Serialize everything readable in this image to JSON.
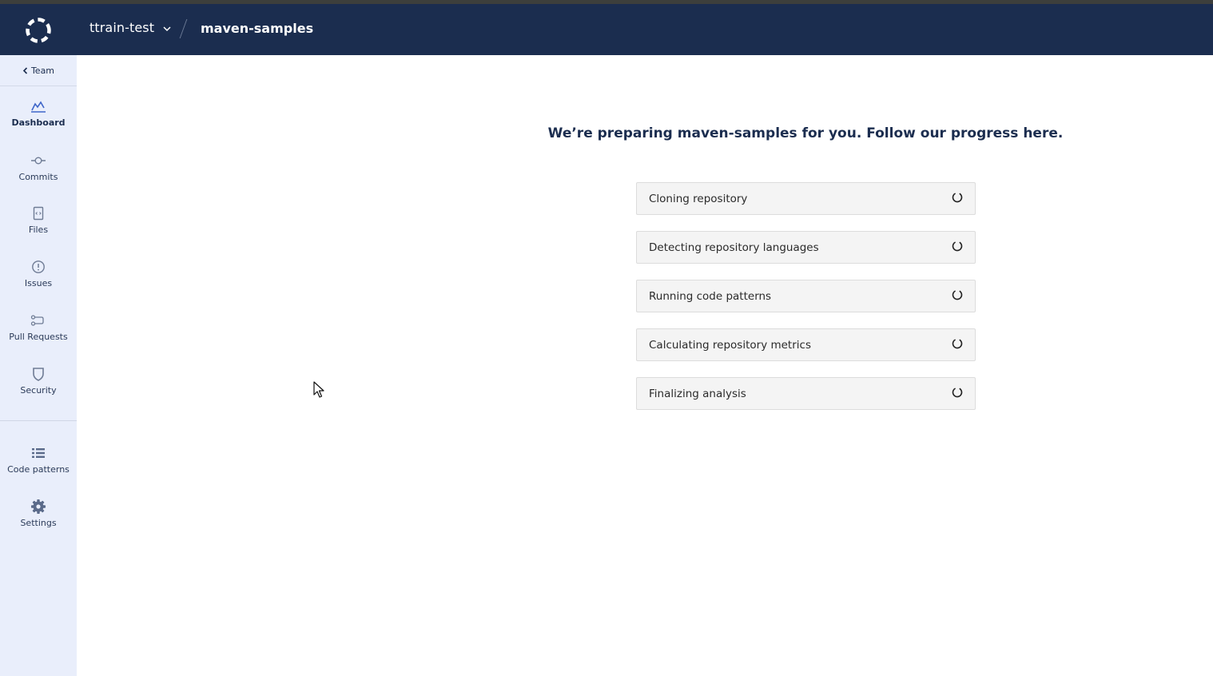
{
  "header": {
    "org_name": "ttrain-test",
    "repo_name": "maven-samples"
  },
  "sidebar": {
    "back_label": "Team",
    "items": [
      {
        "label": "Dashboard",
        "icon": "chart-icon",
        "active": true
      },
      {
        "label": "Commits",
        "icon": "commit-icon"
      },
      {
        "label": "Files",
        "icon": "file-icon"
      },
      {
        "label": "Issues",
        "icon": "alert-icon"
      },
      {
        "label": "Pull Requests",
        "icon": "pull-request-icon"
      },
      {
        "label": "Security",
        "icon": "shield-icon"
      },
      {
        "label": "Code patterns",
        "icon": "list-icon"
      },
      {
        "label": "Settings",
        "icon": "gear-icon"
      }
    ]
  },
  "main": {
    "headline": "We’re preparing maven-samples for you. Follow our progress here.",
    "steps": [
      {
        "label": "Cloning repository",
        "status": "loading"
      },
      {
        "label": "Detecting repository languages",
        "status": "loading"
      },
      {
        "label": "Running code patterns",
        "status": "loading"
      },
      {
        "label": "Calculating repository metrics",
        "status": "loading"
      },
      {
        "label": "Finalizing analysis",
        "status": "loading"
      }
    ]
  },
  "colors": {
    "topbar": "#1b2d4f",
    "sidebar": "#e9eefb",
    "accent": "#3f66c9"
  }
}
